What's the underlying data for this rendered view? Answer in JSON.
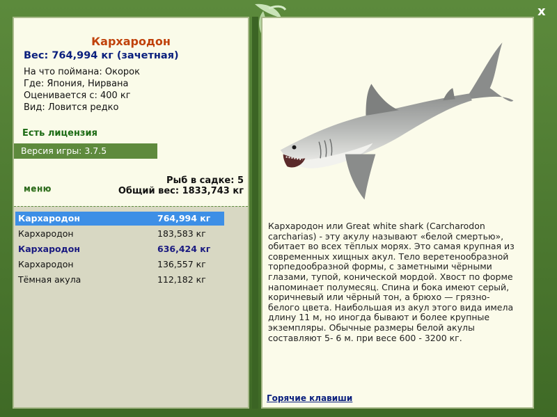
{
  "window": {
    "close_label": "x"
  },
  "fish": {
    "title": "Кархародон",
    "weight_line": "Вес: 764,994 кг (зачетная)",
    "caught_on": "На что поймана: Окорок",
    "where": "Где: Япония, Нирвана",
    "valued": "Оценивается с: 400 кг",
    "type": "Вид: Ловится редко"
  },
  "license": "Есть лицензия",
  "version": "Версия игры: 3.7.5",
  "menu_label": "меню",
  "stats": {
    "fish_count": "Рыб в садке: 5",
    "total_weight": "Общий вес: 1833,743 кг"
  },
  "catch_list": [
    {
      "name": "Кархародон",
      "weight": "764,994 кг",
      "state": "selected"
    },
    {
      "name": "Кархародон",
      "weight": "183,583 кг",
      "state": "normal"
    },
    {
      "name": "Кархародон",
      "weight": "636,424 кг",
      "state": "trophy"
    },
    {
      "name": "Кархародон",
      "weight": "136,557 кг",
      "state": "normal"
    },
    {
      "name": "Тёмная акула",
      "weight": "112,182 кг",
      "state": "normal"
    }
  ],
  "description": "Кархародон или Great white shark (Carcharodon carcharias) - эту акулу называют «белой смертью», обитает во всех тёплых морях. Это самая крупная из современных хищных акул. Тело веретенообразной торпедообразной формы, с заметными чёрными глазами, тупой, конической мордой. Хвост по форме напоминает полумесяц. Спина и бока имеют серый, коричневый или чёрный тон, а брюхо — грязно-белого цвета. Наибольшая из акул этого вида имела длину 11 м, но иногда бывают и более крупные экземпляры. Обычные размеры белой акулы составляют 5- 6 м. при весе 600 - 3200 кг.",
  "hotkeys_label": "Горячие клавиши",
  "colors": {
    "frame": "#4e7a33",
    "panel": "#fafbe9",
    "title": "#c0420b",
    "weight": "#0a1f7d",
    "license": "#1c6b14",
    "selection": "#3d8fe6"
  }
}
